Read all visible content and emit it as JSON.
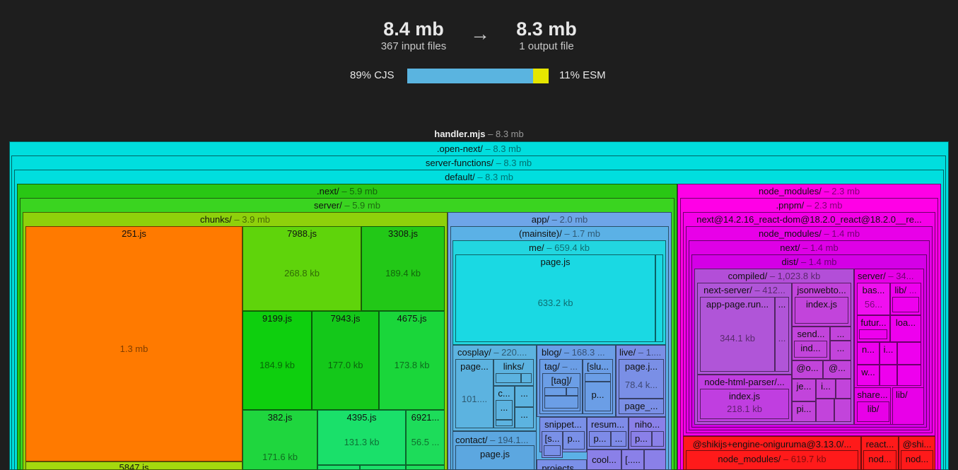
{
  "summary": {
    "input_size": "8.4 mb",
    "input_files": "367 input files",
    "arrow": "→",
    "output_size": "8.3 mb",
    "output_files": "1 output file",
    "cjs_label": "89% CJS",
    "esm_label": "11% ESM",
    "cjs_fraction": 0.89,
    "esm_fraction": 0.11,
    "cjs_color": "#5ab4e0",
    "esm_color": "#e6e600"
  },
  "root": {
    "name": "handler.mjs",
    "size": "– 8.3 mb"
  },
  "tree": {
    "open_next": {
      "name": ".open-next/",
      "size": "– 8.3 mb"
    },
    "server_functions": {
      "name": "server-functions/",
      "size": "– 8.3 mb"
    },
    "default": {
      "name": "default/",
      "size": "– 8.3 mb"
    },
    "next": {
      "name": ".next/",
      "size": "– 5.9 mb"
    },
    "server": {
      "name": "server/",
      "size": "– 5.9 mb"
    },
    "chunks": {
      "name": "chunks/",
      "size": "– 3.9 mb"
    },
    "files": {
      "f251": {
        "name": "251.js",
        "value": "1.3 mb"
      },
      "f7988": {
        "name": "7988.js",
        "value": "268.8 kb"
      },
      "f3308": {
        "name": "3308.js",
        "value": "189.4 kb"
      },
      "f9199": {
        "name": "9199.js",
        "value": "184.9 kb"
      },
      "f7943": {
        "name": "7943.js",
        "value": "177.0 kb"
      },
      "f4675": {
        "name": "4675.js",
        "value": "173.8 kb"
      },
      "f382": {
        "name": "382.js",
        "value": "171.6 kb"
      },
      "f4395": {
        "name": "4395.js",
        "value": "131.3 kb"
      },
      "f6921": {
        "name": "6921...",
        "value": "56.5 ..."
      },
      "f5847": {
        "name": "5847.js"
      }
    },
    "app": {
      "name": "app/",
      "size": "– 2.0 mb"
    },
    "mainsite": {
      "name": "(mainsite)/",
      "size": "– 1.7 mb"
    },
    "me": {
      "name": "me/",
      "size": "– 659.4 kb"
    },
    "me_page": {
      "name": "page.js",
      "value": "633.2 kb"
    },
    "cosplay": {
      "name": "cosplay/",
      "size": "– 220...."
    },
    "cosplay_page": {
      "name": "page...",
      "value": "101...."
    },
    "cosplay_links": {
      "name": "links/",
      "more": "...",
      "c": "c...",
      "dots": "..."
    },
    "blog": {
      "name": "blog/",
      "size": "– 168.3 ..."
    },
    "blog_tag": {
      "name": "tag/",
      "size": "– ...",
      "inner": "[tag]/"
    },
    "blog_slug": {
      "name": "[slu...",
      "p": "p..."
    },
    "live": {
      "name": "live/",
      "size": "– 1...."
    },
    "live_page": {
      "name": "page.j...",
      "value": "78.4 k..."
    },
    "live_page2": {
      "name": "page_..."
    },
    "snippet": {
      "name": "snippet...",
      "s": "[s...",
      "p": "p..."
    },
    "resume": {
      "name": "resum...",
      "p": "p...",
      "dots": "..."
    },
    "niho": {
      "name": "niho...",
      "p": "p..."
    },
    "cool": {
      "name": "cool..."
    },
    "bracket": {
      "name": "[....."
    },
    "contact": {
      "name": "contact/",
      "size": "– 194.1..."
    },
    "contact_page": {
      "name": "page.js"
    },
    "projects": {
      "name": "projects..."
    },
    "node_modules": {
      "name": "node_modules/",
      "size": "– 2.3 mb"
    },
    "pnpm": {
      "name": ".pnpm/",
      "size": "– 2.3 mb"
    },
    "next_pkg": {
      "name": "next@14.2.16_react-dom@18.2.0_react@18.2.0__re...",
      "size": ""
    },
    "nm2": {
      "name": "node_modules/",
      "size": "– 1.4 mb"
    },
    "next_dir": {
      "name": "next/",
      "size": "– 1.4 mb"
    },
    "dist": {
      "name": "dist/",
      "size": "– 1.4 mb"
    },
    "compiled": {
      "name": "compiled/",
      "size": "– 1,023.8 kb"
    },
    "next_server": {
      "name": "next-server/",
      "size": "– 412..."
    },
    "app_page": {
      "name": "app-page.run...",
      "value": "344.1 kb",
      "dots": "...",
      "dots2": "..."
    },
    "jsonwebto": {
      "name": "jsonwebto...",
      "index": "index.js"
    },
    "send": {
      "name": "send...",
      "ind": "ind...",
      "dots": "..."
    },
    "at_o": {
      "name": "@o..."
    },
    "at2": {
      "name": "@..."
    },
    "node_html_parser": {
      "name": "node-html-parser/...",
      "index": "index.js",
      "value": "218.1 kb"
    },
    "je": {
      "name": "je..."
    },
    "i_dots": {
      "name": "i..."
    },
    "pi": {
      "name": "pi..."
    },
    "server2": {
      "name": "server/",
      "size": "– 34..."
    },
    "bas": {
      "name": "bas...",
      "value": "56..."
    },
    "lib": {
      "name": "lib/",
      "size": "..."
    },
    "futur": {
      "name": "futur..."
    },
    "loa": {
      "name": "loa..."
    },
    "n": {
      "name": "n..."
    },
    "i2": {
      "name": "i..."
    },
    "w": {
      "name": "w..."
    },
    "share": {
      "name": "share..."
    },
    "lib2": {
      "name": "lib/"
    },
    "lib3": {
      "name": "lib/"
    },
    "shiki": {
      "name": "@shikijs+engine-oniguruma@3.13.0/..."
    },
    "shiki_nm": {
      "name": "node_modules/",
      "size": "– 619.7 kb"
    },
    "react": {
      "name": "react..."
    },
    "react_nod": {
      "name": "nod..."
    },
    "shi": {
      "name": "@shi..."
    },
    "shi_nod": {
      "name": "nod..."
    }
  },
  "colors": {
    "cyan": "#00dede",
    "green_dark": "#33cc22",
    "green_light": "#5cd92a",
    "lime": "#99d90f",
    "orange": "#ff7700",
    "magenta": "#ff00ee",
    "violet": "#b055d8",
    "red": "#ff1a1a",
    "blue": "#6ea5e8"
  }
}
